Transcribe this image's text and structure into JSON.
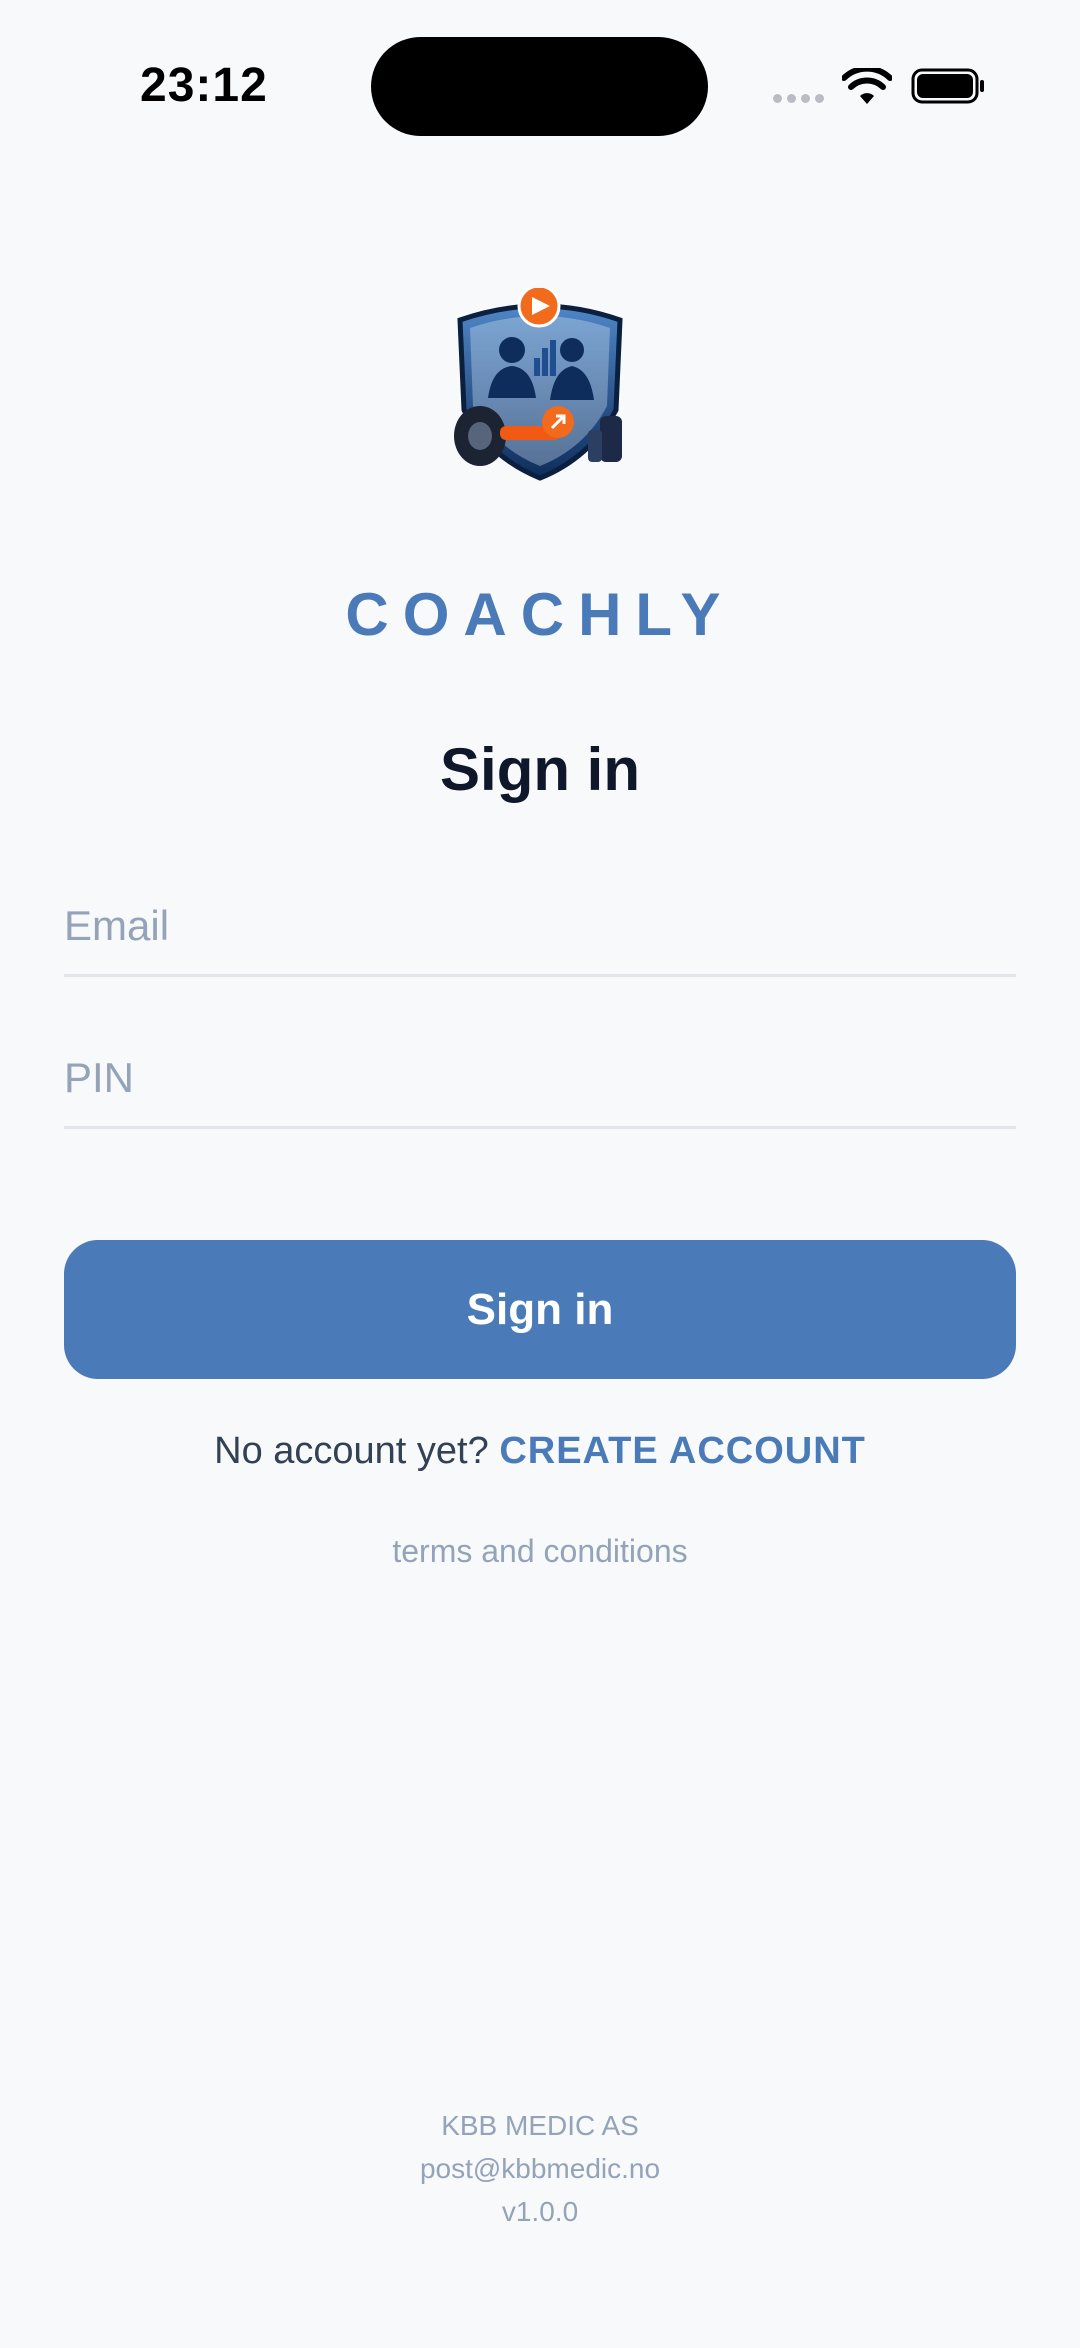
{
  "status_bar": {
    "time": "23:12"
  },
  "app": {
    "brand": "COACHLY",
    "logo_icon": "coachly-shield-logo"
  },
  "signin": {
    "title": "Sign in",
    "email_placeholder": "Email",
    "email_value": "",
    "pin_placeholder": "PIN",
    "pin_value": "",
    "button_label": "Sign in",
    "no_account_text": "No account yet?",
    "create_account_label": "CREATE ACCOUNT",
    "terms_label": "terms and conditions"
  },
  "footer": {
    "company": "KBB MEDIC AS",
    "email": "post@kbbmedic.no",
    "version": "v1.0.0"
  },
  "colors": {
    "background": "#f8f9fb",
    "accent": "#4a7ab7",
    "title": "#0f172a",
    "muted": "#94a3b8"
  }
}
